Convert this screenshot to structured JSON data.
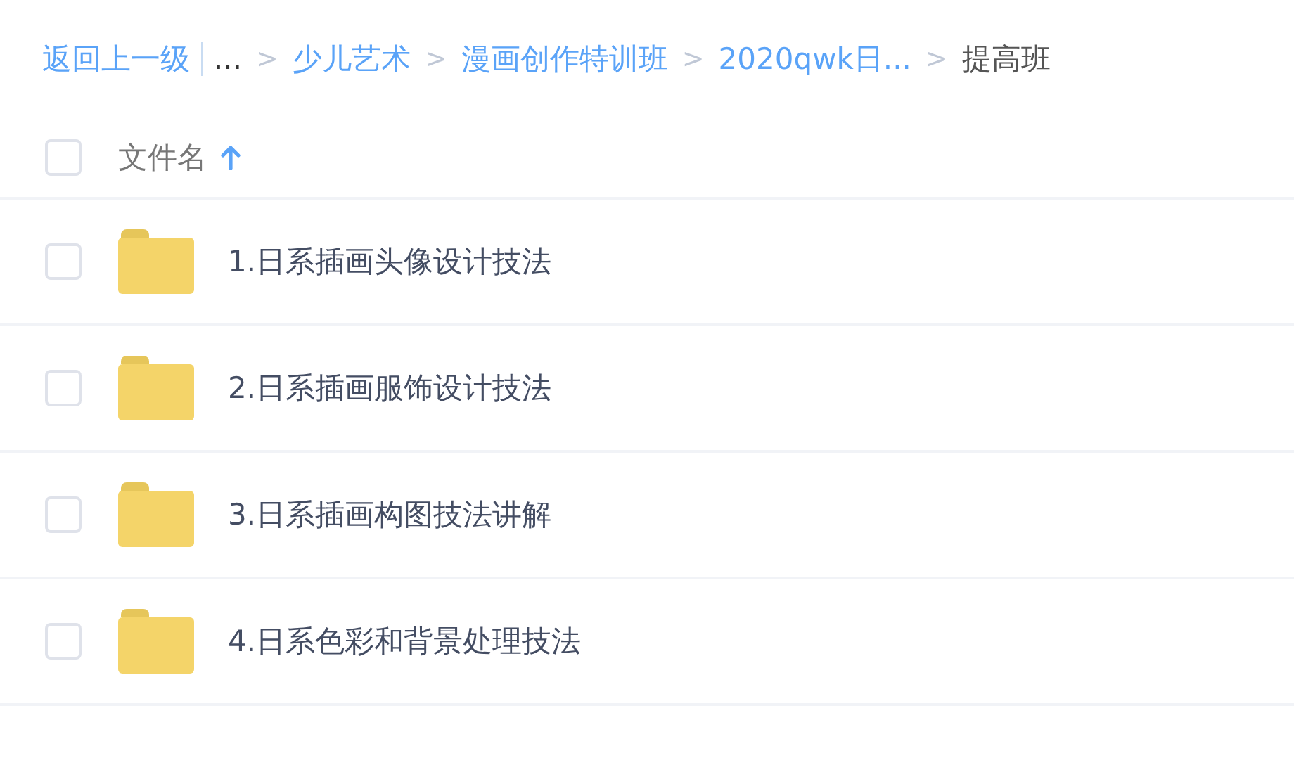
{
  "breadcrumb": {
    "back": "返回上一级",
    "items": [
      {
        "kind": "ellipsis",
        "label": "..."
      },
      {
        "kind": "link",
        "separator": ">",
        "label": "少儿艺术"
      },
      {
        "kind": "link",
        "separator": ">",
        "label": "漫画创作特训班"
      },
      {
        "kind": "link",
        "separator": ">",
        "label": "2020qwk日..."
      },
      {
        "kind": "current",
        "separator": ">",
        "label": "提高班"
      }
    ]
  },
  "header": {
    "checked": false,
    "label": "文件名",
    "ascending": true
  },
  "files": [
    {
      "kind": "folder",
      "checked": false,
      "name": "1.日系插画头像设计技法"
    },
    {
      "kind": "folder",
      "checked": false,
      "name": "2.日系插画服饰设计技法"
    },
    {
      "kind": "folder",
      "checked": false,
      "name": "3.日系插画构图技法讲解"
    },
    {
      "kind": "folder",
      "checked": false,
      "name": "4.日系色彩和背景处理技法"
    }
  ]
}
